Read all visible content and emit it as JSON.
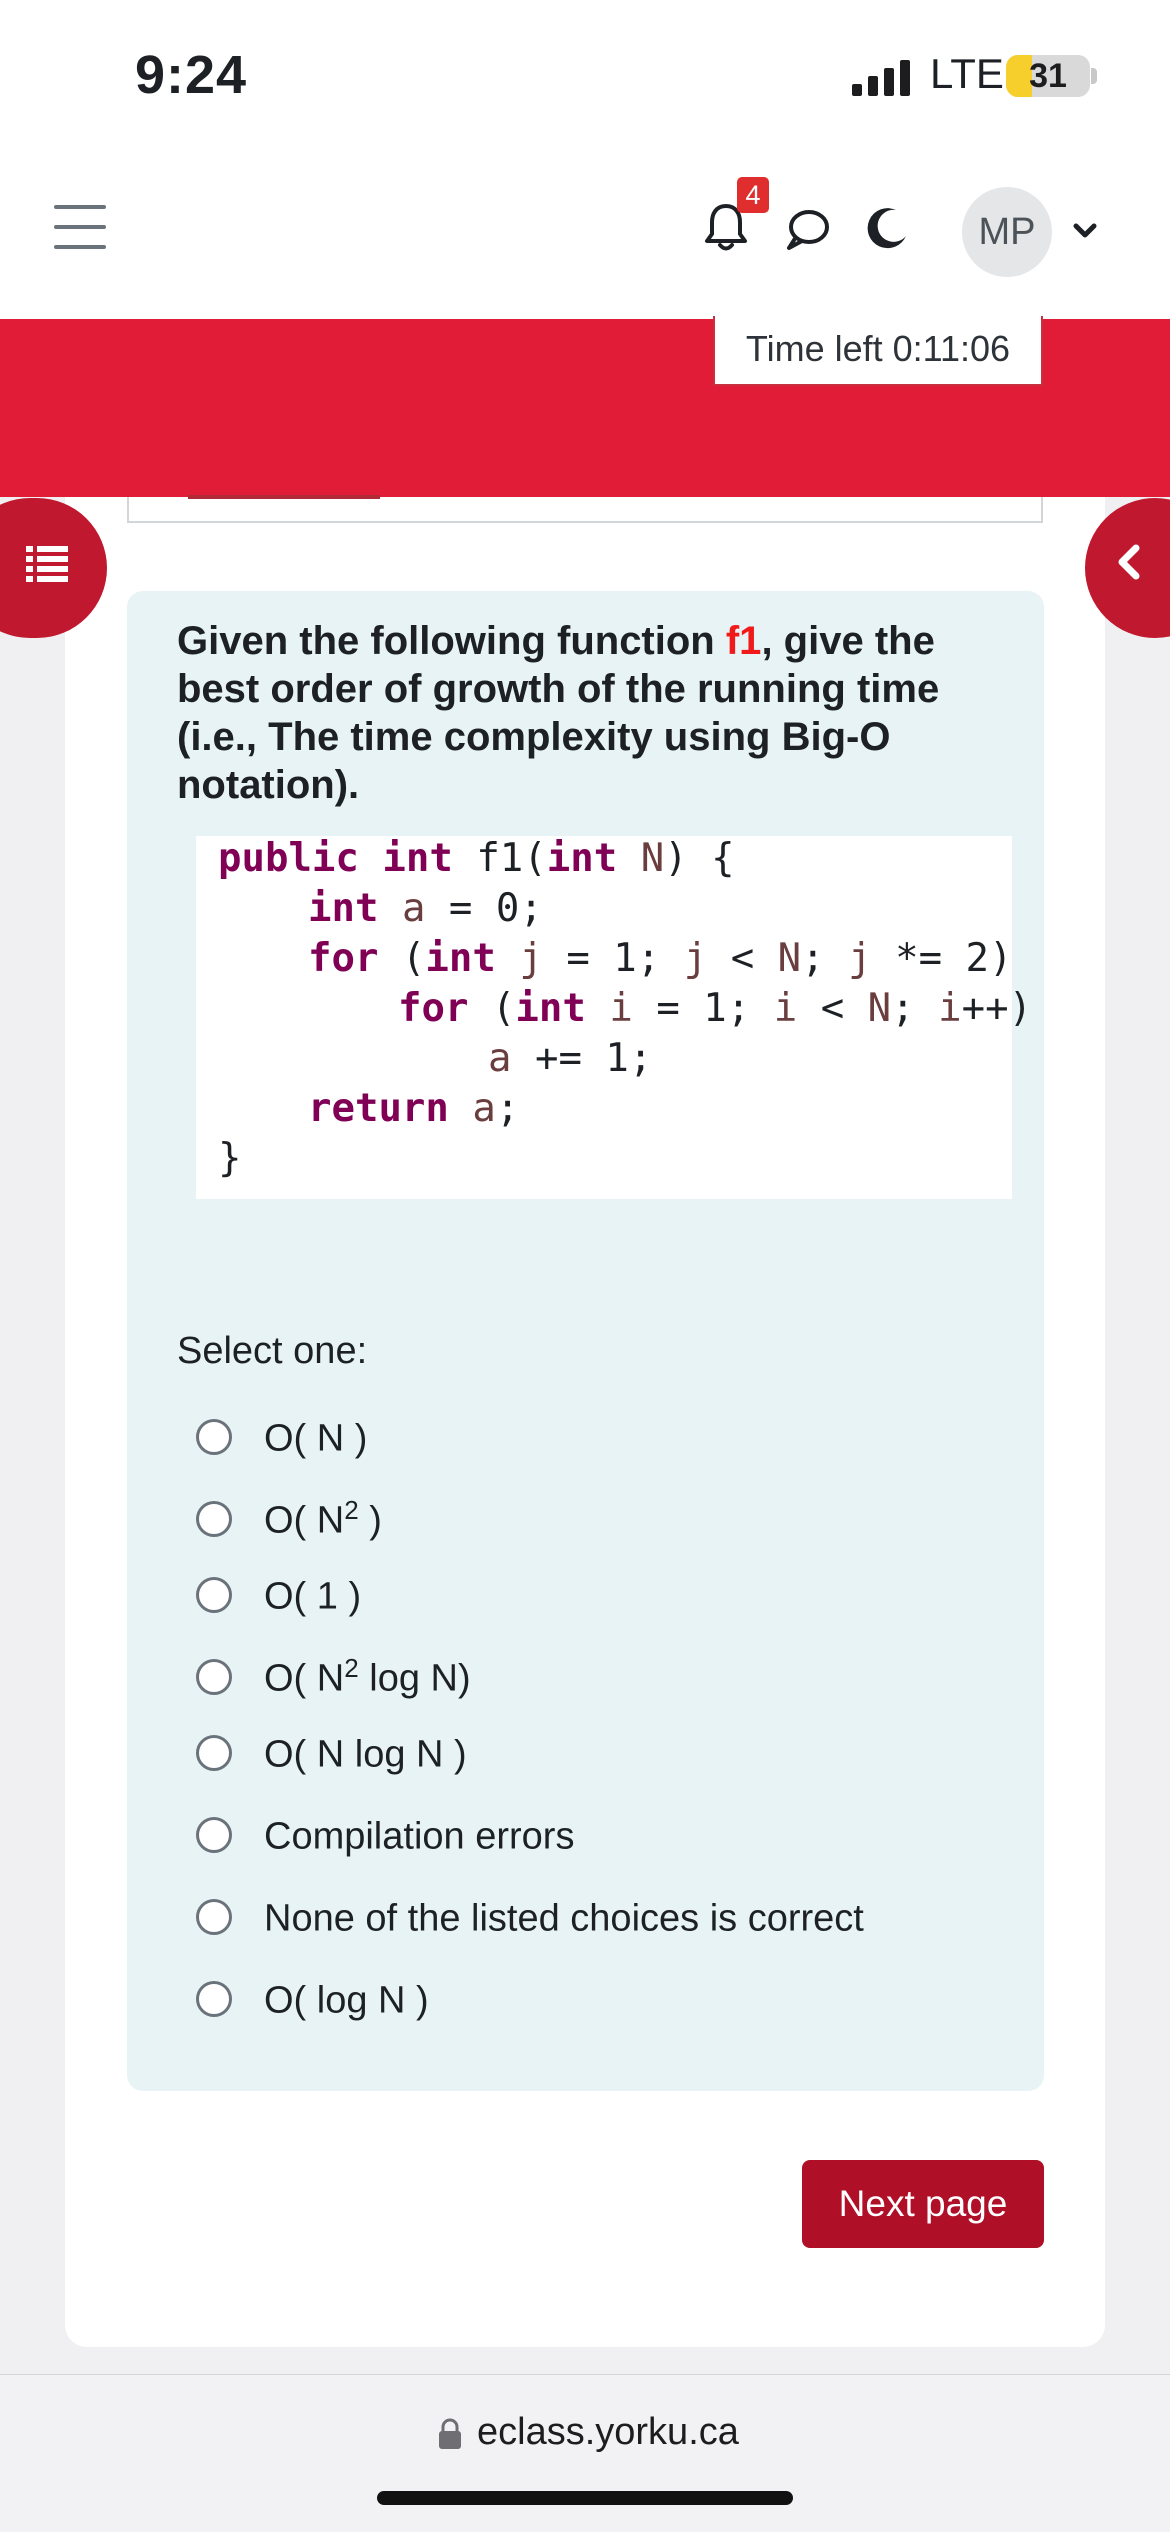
{
  "status_bar": {
    "time": "9:24",
    "network": "LTE",
    "battery_percent": "31",
    "battery_level": 0.31
  },
  "navbar": {
    "notification_count": "4",
    "avatar_initials": "MP",
    "icons": [
      "hamburger-icon",
      "bell-icon",
      "chat-icon",
      "moon-icon",
      "chevron-down-icon"
    ]
  },
  "quiz": {
    "timer": "Time left 0:11:06",
    "question_prefix": "Given the following function ",
    "function_name": "f1",
    "question_suffix": ", give the best order of growth of the running time (i.e., The time complexity using Big-O notation).",
    "code": {
      "line1_kw1": "public",
      "line1_kw2": "int",
      "line1_name": "f1(",
      "line1_kw3": "int",
      "line1_param": "N",
      "line1_end": ") {",
      "line2_kw": "int",
      "line2_var": "a",
      "line2_rest": " = 0;",
      "line3_kw1": "for",
      "line3_open": " (",
      "line3_kw2": "int",
      "line3_j1": "j",
      "line3_mid1": " = 1; ",
      "line3_j2": "j",
      "line3_mid2": " < ",
      "line3_n": "N",
      "line3_mid3": "; ",
      "line3_j3": "j",
      "line3_end": " *= 2)",
      "line4_kw1": "for",
      "line4_open": " (",
      "line4_kw2": "int",
      "line4_i1": "i",
      "line4_mid1": " = 1; ",
      "line4_i2": "i",
      "line4_mid2": " < ",
      "line4_n": "N",
      "line4_mid3": "; ",
      "line4_i3": "i",
      "line4_end": "++)",
      "line5_var": "a",
      "line5_rest": " += 1;",
      "line6_kw": "return",
      "line6_var": "a",
      "line6_end": ";",
      "line7": "}"
    },
    "select_prompt": "Select one:",
    "options": [
      {
        "pre": "O( N )",
        "sup": "",
        "post": ""
      },
      {
        "pre": "O( N",
        "sup": "2",
        "post": " )"
      },
      {
        "pre": "O( 1 )",
        "sup": "",
        "post": ""
      },
      {
        "pre": "O( N",
        "sup": "2",
        "post": " log N)"
      },
      {
        "pre": "O( N log N )",
        "sup": "",
        "post": ""
      },
      {
        "pre": "Compilation errors",
        "sup": "",
        "post": ""
      },
      {
        "pre": "None of the listed choices is correct",
        "sup": "",
        "post": ""
      },
      {
        "pre": "O( log N )",
        "sup": "",
        "post": ""
      }
    ],
    "next_label": "Next page"
  },
  "browser": {
    "url": "eclass.yorku.ca"
  },
  "colors": {
    "brand_red": "#e11c37",
    "button_red": "#b00f28",
    "question_bg": "#e7f3f5",
    "keyword": "#7f0055"
  }
}
